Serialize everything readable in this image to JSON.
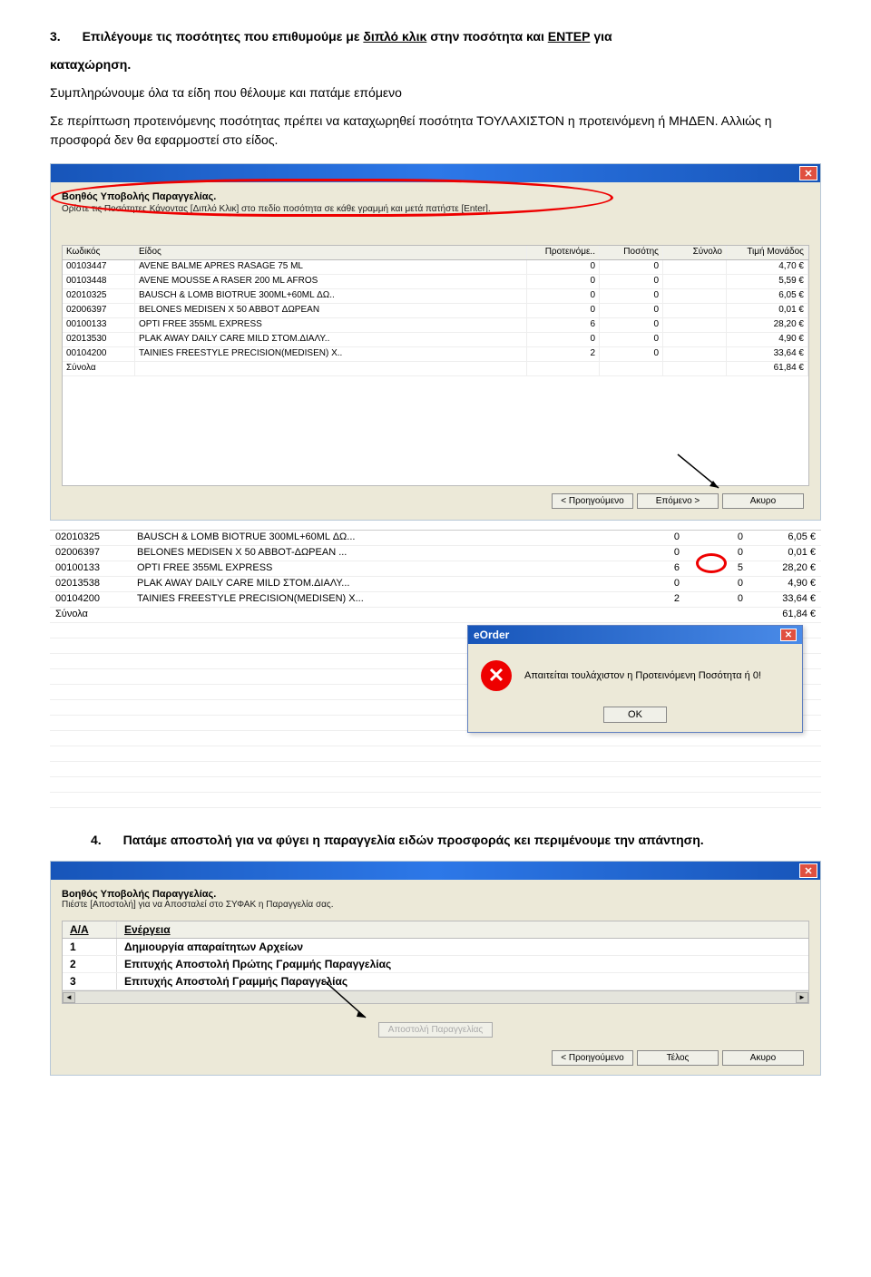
{
  "step3": {
    "num": "3.",
    "line1a": "Επιλέγουμε τις ποσότητες που επιθυμούμε  με ",
    "line1b": "διπλό κλικ",
    "line1c": " στην ποσότητα και ",
    "line1d": "ENTEP",
    "line1e": " για ",
    "line2": "καταχώρηση.",
    "body1": "Συμπληρώνουμε όλα τα είδη που θέλουμε και πατάμε επόμενο",
    "body2": "Σε περίπτωση προτεινόμενης ποσότητας πρέπει να καταχωρηθεί ποσότητα ΤΟΥΛΑΧΙΣΤΟΝ η προτεινόμενη ή ΜΗΔΕΝ. Αλλιώς η προσφορά δεν θα εφαρμοστεί στο είδος."
  },
  "wizard1": {
    "title": "Βοηθός Υποβολής Παραγγελίας.",
    "subtitle": "Ορίστε τις Ποσότητες Κάνοντας [Διπλό Κλικ] στο πεδίο ποσότητα σε κάθε γραμμή και μετά πατήστε [Enter].",
    "cols": {
      "code": "Κωδικός",
      "name": "Είδος",
      "sug": "Προτεινόμε..",
      "qty": "Ποσότης",
      "total": "Σύνολο",
      "unit": "Τιμή Μονάδος"
    },
    "rows": [
      {
        "code": "00103447",
        "name": "AVENE BALME APRES RASAGE 75 ML",
        "sug": "0",
        "qty": "0",
        "total": "",
        "unit": "4,70 €"
      },
      {
        "code": "00103448",
        "name": "AVENE MOUSSE A RASER 200 ML AFROS",
        "sug": "0",
        "qty": "0",
        "total": "",
        "unit": "5,59 €"
      },
      {
        "code": "02010325",
        "name": "BAUSCH & LOMB BIOTRUE 300ML+60ML ΔΩ..",
        "sug": "0",
        "qty": "0",
        "total": "",
        "unit": "6,05 €"
      },
      {
        "code": "02006397",
        "name": "BELONES MEDISEN X 50 ABBOT ΔΩΡΕΑΝ",
        "sug": "0",
        "qty": "0",
        "total": "",
        "unit": "0,01 €"
      },
      {
        "code": "00100133",
        "name": "OPTI FREE 355ML EXPRESS",
        "sug": "6",
        "qty": "0",
        "total": "",
        "unit": "28,20 €"
      },
      {
        "code": "02013530",
        "name": "PLAK AWAY DAILY CARE MILD ΣΤΟΜ.ΔΙΑΛΥ..",
        "sug": "0",
        "qty": "0",
        "total": "",
        "unit": "4,90 €"
      },
      {
        "code": "00104200",
        "name": "TAINIES FREESTYLE PRECISION(MEDISEN) X..",
        "sug": "2",
        "qty": "0",
        "total": "",
        "unit": "33,64 €"
      }
    ],
    "totals_label": "Σύνολα",
    "totals_value": "61,84 €",
    "btn_prev": "< Προηγούμενο",
    "btn_next": "Επόμενο >",
    "btn_cancel": "Ακυρο"
  },
  "grid2": {
    "rows": [
      {
        "code": "02010325",
        "name": "BAUSCH & LOMB BIOTRUE 300ML+60ML ΔΩ...",
        "a": "0",
        "b": "0",
        "c": "6,05 €"
      },
      {
        "code": "02006397",
        "name": "BELONES MEDISEN X 50 ABBOT-ΔΩΡΕΑΝ    ...",
        "a": "0",
        "b": "0",
        "c": "0,01 €"
      },
      {
        "code": "00100133",
        "name": "OPTI FREE 355ML EXPRESS",
        "a": "6",
        "b": "5",
        "c": "28,20 €"
      },
      {
        "code": "02013538",
        "name": "PLAK AWAY DAILY CARE MILD ΣΤΟΜ.ΔΙΑΛΥ...",
        "a": "0",
        "b": "0",
        "c": "4,90 €"
      },
      {
        "code": "00104200",
        "name": "TAINIES FREESTYLE PRECISION(MEDISEN) X...",
        "a": "2",
        "b": "0",
        "c": "33,64 €"
      }
    ],
    "totals_label": "Σύνολα",
    "totals_value": "61,84 €"
  },
  "msgbox": {
    "title": "eOrder",
    "text": "Απαιτείται τουλάχιστον η Προτεινόμενη Ποσότητα ή 0!",
    "ok": "OK"
  },
  "step4": {
    "num": "4.",
    "text": "Πατάμε αποστολή για να φύγει η παραγγελία ειδών προσφοράς κει περιμένουμε την απάντηση."
  },
  "wizard2": {
    "title": "Βοηθός Υποβολής Παραγγελίας.",
    "subtitle": "Πιέστε [Αποστολή] για να Αποσταλεί στο ΣΥΦΑΚ η Παραγγελία σας.",
    "col_aa": "A/A",
    "col_act": "Ενέργεια",
    "rows": [
      {
        "n": "1",
        "a": "Δημιουργία απαραίτητων Αρχείων"
      },
      {
        "n": "2",
        "a": "Επιτυχής Αποστολή Πρώτης Γραμμής Παραγγελίας"
      },
      {
        "n": "3",
        "a": "Επιτυχής Αποστολή Γραμμής Παραγγελίας"
      }
    ],
    "send_btn": "Αποστολή Παραγγελίας",
    "btn_prev": "< Προηγούμενο",
    "btn_next": "Τέλος",
    "btn_cancel": "Ακυρο"
  }
}
